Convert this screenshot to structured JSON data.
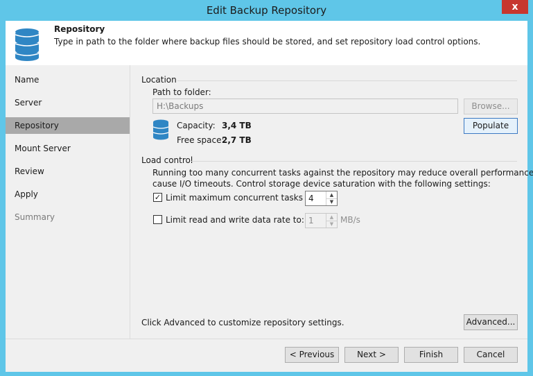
{
  "window": {
    "title": "Edit Backup Repository",
    "close_glyph": "x"
  },
  "header": {
    "title": "Repository",
    "description": "Type in path to the folder where backup files should be stored, and set repository load control options.",
    "icon": "database-icon"
  },
  "nav": {
    "items": [
      {
        "label": "Name",
        "state": "normal"
      },
      {
        "label": "Server",
        "state": "normal"
      },
      {
        "label": "Repository",
        "state": "active"
      },
      {
        "label": "Mount Server",
        "state": "normal"
      },
      {
        "label": "Review",
        "state": "normal"
      },
      {
        "label": "Apply",
        "state": "normal"
      },
      {
        "label": "Summary",
        "state": "disabled"
      }
    ]
  },
  "location": {
    "group_label": "Location",
    "path_label": "Path to folder:",
    "path_value": "H:\\Backups",
    "browse_label": "Browse...",
    "populate_label": "Populate",
    "capacity_label": "Capacity:",
    "capacity_value": "3,4 TB",
    "free_label": "Free space:",
    "free_value": "2,7 TB"
  },
  "load_control": {
    "group_label": "Load control",
    "description_line1": "Running too many concurrent tasks against the repository may reduce overall performance, and",
    "description_line2": "cause I/O timeouts. Control storage device saturation with the following settings:",
    "limit_tasks_label": "Limit maximum concurrent tasks to:",
    "limit_tasks_checked": true,
    "limit_tasks_value": "4",
    "limit_rate_label": "Limit read and write data rate to:",
    "limit_rate_checked": false,
    "limit_rate_value": "1",
    "rate_unit": "MB/s"
  },
  "advanced": {
    "hint": "Click Advanced to customize repository settings.",
    "button_label": "Advanced..."
  },
  "footer": {
    "previous_label": "< Previous",
    "next_label": "Next >",
    "finish_label": "Finish",
    "cancel_label": "Cancel"
  },
  "colors": {
    "window_frame": "#5fc6e8",
    "close_button": "#c7372f",
    "nav_active": "#a9a9a9",
    "database_icon": "#2f86c4"
  }
}
